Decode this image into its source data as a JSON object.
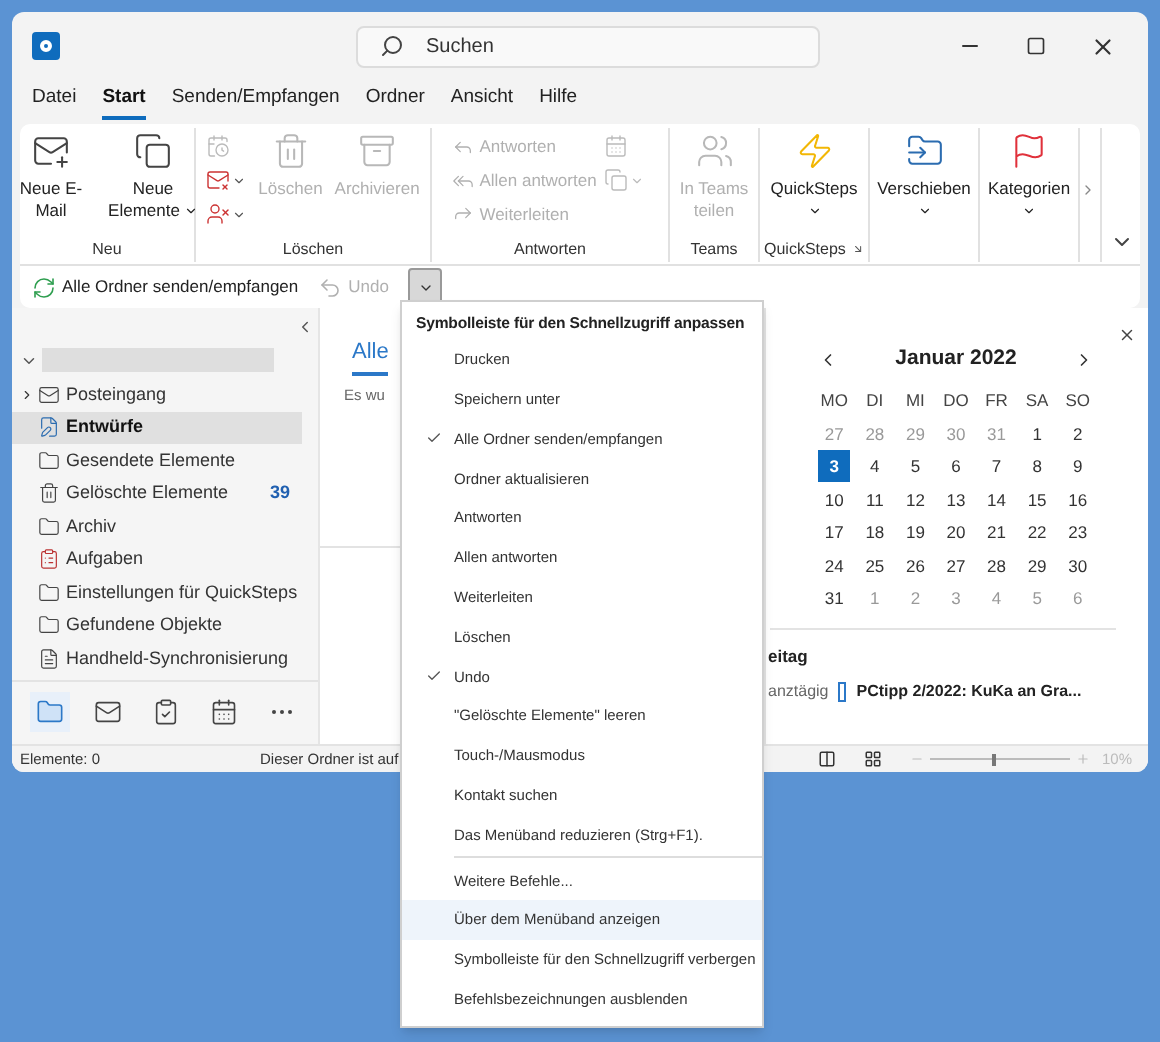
{
  "window": {
    "search_placeholder": "Suchen"
  },
  "tabs": [
    {
      "label": "Datei",
      "selected": false
    },
    {
      "label": "Start",
      "selected": true
    },
    {
      "label": "Senden/Empfangen",
      "selected": false
    },
    {
      "label": "Ordner",
      "selected": false
    },
    {
      "label": "Ansicht",
      "selected": false
    },
    {
      "label": "Hilfe",
      "selected": false
    }
  ],
  "ribbon": {
    "groups": [
      {
        "label": "Neu",
        "items": [
          {
            "kind": "large",
            "label": "Neue E-Mail",
            "disabled": false,
            "dropdown": false
          },
          {
            "kind": "large",
            "label": "Neue Elemente",
            "disabled": false,
            "dropdown": true
          }
        ]
      },
      {
        "label": "Löschen",
        "items": [
          {
            "kind": "icon_stack",
            "entries": [
              {
                "disabled": true,
                "dropdown": false
              },
              {
                "disabled": false,
                "dropdown": true
              },
              {
                "disabled": false,
                "dropdown": true
              }
            ]
          },
          {
            "kind": "large",
            "label": "Löschen",
            "disabled": true,
            "dropdown": false
          },
          {
            "kind": "large",
            "label": "Archivieren",
            "disabled": true,
            "dropdown": false
          }
        ]
      },
      {
        "label": "Antworten",
        "items": [
          {
            "kind": "text_stack",
            "entries": [
              {
                "label": "Antworten",
                "disabled": true
              },
              {
                "label": "Allen antworten",
                "disabled": true
              },
              {
                "label": "Weiterleiten",
                "disabled": true
              }
            ]
          },
          {
            "kind": "icon_stack",
            "entries": [
              {
                "disabled": true,
                "dropdown": false
              },
              {
                "disabled": true,
                "dropdown": true
              }
            ]
          }
        ]
      },
      {
        "label": "Teams",
        "items": [
          {
            "kind": "large",
            "label": "In Teams teilen",
            "disabled": true,
            "dropdown": false
          }
        ]
      },
      {
        "label": "QuickSteps",
        "launcher": true,
        "items": [
          {
            "kind": "large",
            "label": "QuickSteps",
            "disabled": false,
            "dropdown": true
          }
        ]
      },
      {
        "items": [
          {
            "kind": "large",
            "label": "Verschieben",
            "disabled": false,
            "dropdown": true
          }
        ]
      },
      {
        "items": [
          {
            "kind": "large",
            "label": "Kategorien",
            "disabled": false,
            "dropdown": true
          }
        ]
      }
    ]
  },
  "quick_access": {
    "items": [
      {
        "label": "Alle Ordner senden/empfangen",
        "disabled": false
      },
      {
        "label": "Undo",
        "disabled": true
      }
    ],
    "menu_open": true
  },
  "folder_pane": {
    "folders": [
      {
        "label": "Posteingang",
        "selected": false,
        "collapsed": true
      },
      {
        "label": "Entwürfe",
        "selected": true,
        "collapsed": false
      },
      {
        "label": "Gesendete Elemente",
        "selected": false,
        "collapsed": false
      },
      {
        "label": "Gelöschte Elemente",
        "selected": false,
        "collapsed": false,
        "count": "39"
      },
      {
        "label": "Archiv",
        "selected": false,
        "collapsed": false
      },
      {
        "label": "Aufgaben",
        "selected": false,
        "collapsed": false
      },
      {
        "label": "Einstellungen für QuickSteps",
        "selected": false,
        "collapsed": false
      },
      {
        "label": "Gefundene Objekte",
        "selected": false,
        "collapsed": false
      },
      {
        "label": "Handheld-Synchronisierung",
        "selected": false,
        "collapsed": false
      }
    ],
    "nav": [
      {
        "selected": true
      },
      {
        "selected": false
      },
      {
        "selected": false
      },
      {
        "selected": false
      },
      {
        "selected": false
      }
    ]
  },
  "message_list": {
    "tab": "Alle",
    "empty_text": "Es wu"
  },
  "calendar": {
    "month": "Januar 2022",
    "weekdays": [
      "MO",
      "DI",
      "MI",
      "DO",
      "FR",
      "SA",
      "SO"
    ],
    "days": [
      {
        "label": "27",
        "muted": true,
        "selected": false
      },
      {
        "label": "28",
        "muted": true,
        "selected": false
      },
      {
        "label": "29",
        "muted": true,
        "selected": false
      },
      {
        "label": "30",
        "muted": true,
        "selected": false
      },
      {
        "label": "31",
        "muted": true,
        "selected": false
      },
      {
        "label": "1",
        "muted": false,
        "selected": false
      },
      {
        "label": "2",
        "muted": false,
        "selected": false
      },
      {
        "label": "3",
        "muted": false,
        "selected": true
      },
      {
        "label": "4",
        "muted": false,
        "selected": false
      },
      {
        "label": "5",
        "muted": false,
        "selected": false
      },
      {
        "label": "6",
        "muted": false,
        "selected": false
      },
      {
        "label": "7",
        "muted": false,
        "selected": false
      },
      {
        "label": "8",
        "muted": false,
        "selected": false
      },
      {
        "label": "9",
        "muted": false,
        "selected": false
      },
      {
        "label": "10",
        "muted": false,
        "selected": false
      },
      {
        "label": "11",
        "muted": false,
        "selected": false
      },
      {
        "label": "12",
        "muted": false,
        "selected": false
      },
      {
        "label": "13",
        "muted": false,
        "selected": false
      },
      {
        "label": "14",
        "muted": false,
        "selected": false
      },
      {
        "label": "15",
        "muted": false,
        "selected": false
      },
      {
        "label": "16",
        "muted": false,
        "selected": false
      },
      {
        "label": "17",
        "muted": false,
        "selected": false
      },
      {
        "label": "18",
        "muted": false,
        "selected": false
      },
      {
        "label": "19",
        "muted": false,
        "selected": false
      },
      {
        "label": "20",
        "muted": false,
        "selected": false
      },
      {
        "label": "21",
        "muted": false,
        "selected": false
      },
      {
        "label": "22",
        "muted": false,
        "selected": false
      },
      {
        "label": "23",
        "muted": false,
        "selected": false
      },
      {
        "label": "24",
        "muted": false,
        "selected": false
      },
      {
        "label": "25",
        "muted": false,
        "selected": false
      },
      {
        "label": "26",
        "muted": false,
        "selected": false
      },
      {
        "label": "27",
        "muted": false,
        "selected": false
      },
      {
        "label": "28",
        "muted": false,
        "selected": false
      },
      {
        "label": "29",
        "muted": false,
        "selected": false
      },
      {
        "label": "30",
        "muted": false,
        "selected": false
      },
      {
        "label": "31",
        "muted": false,
        "selected": false
      },
      {
        "label": "1",
        "muted": true,
        "selected": false
      },
      {
        "label": "2",
        "muted": true,
        "selected": false
      },
      {
        "label": "3",
        "muted": true,
        "selected": false
      },
      {
        "label": "4",
        "muted": true,
        "selected": false
      },
      {
        "label": "5",
        "muted": true,
        "selected": false
      },
      {
        "label": "6",
        "muted": true,
        "selected": false
      }
    ],
    "agenda_day": "eitag",
    "event": {
      "time": "anztägig",
      "title": "PCtipp 2/2022: KuKa an Gra..."
    }
  },
  "status_bar": {
    "items_text": "Elemente: 0",
    "info": "Dieser Ordner ist auf",
    "zoom": {
      "level": 0.45,
      "reading": "10%"
    }
  },
  "qat_menu": {
    "title": "Symbolleiste für den Schnellzugriff anpassen",
    "items": [
      {
        "kind": "item",
        "label": "Drucken",
        "checked": false,
        "highlighted": false
      },
      {
        "kind": "item",
        "label": "Speichern unter",
        "checked": false,
        "highlighted": false
      },
      {
        "kind": "item",
        "label": "Alle Ordner senden/empfangen",
        "checked": true,
        "highlighted": false
      },
      {
        "kind": "item",
        "label": "Ordner aktualisieren",
        "checked": false,
        "highlighted": false
      },
      {
        "kind": "item",
        "label": "Antworten",
        "checked": false,
        "highlighted": false
      },
      {
        "kind": "item",
        "label": "Allen antworten",
        "checked": false,
        "highlighted": false
      },
      {
        "kind": "item",
        "label": "Weiterleiten",
        "checked": false,
        "highlighted": false
      },
      {
        "kind": "item",
        "label": "Löschen",
        "checked": false,
        "highlighted": false
      },
      {
        "kind": "item",
        "label": "Undo",
        "checked": true,
        "highlighted": false
      },
      {
        "kind": "item",
        "label": "\"Gelöschte Elemente\" leeren",
        "checked": false,
        "highlighted": false
      },
      {
        "kind": "item",
        "label": "Touch-/Mausmodus",
        "checked": false,
        "highlighted": false
      },
      {
        "kind": "item",
        "label": "Kontakt suchen",
        "checked": false,
        "highlighted": false
      },
      {
        "kind": "item",
        "label": "Das Menüband reduzieren (Strg+F1).",
        "checked": false,
        "highlighted": false
      },
      {
        "kind": "separator"
      },
      {
        "kind": "item",
        "label": "Weitere Befehle...",
        "checked": false,
        "highlighted": false
      },
      {
        "kind": "item",
        "label": "Über dem Menüband anzeigen",
        "checked": false,
        "highlighted": true
      },
      {
        "kind": "item",
        "label": "Symbolleiste für den Schnellzugriff verbergen",
        "checked": false,
        "highlighted": false
      },
      {
        "kind": "item",
        "label": "Befehlsbezeichnungen ausblenden",
        "checked": false,
        "highlighted": false
      }
    ]
  }
}
